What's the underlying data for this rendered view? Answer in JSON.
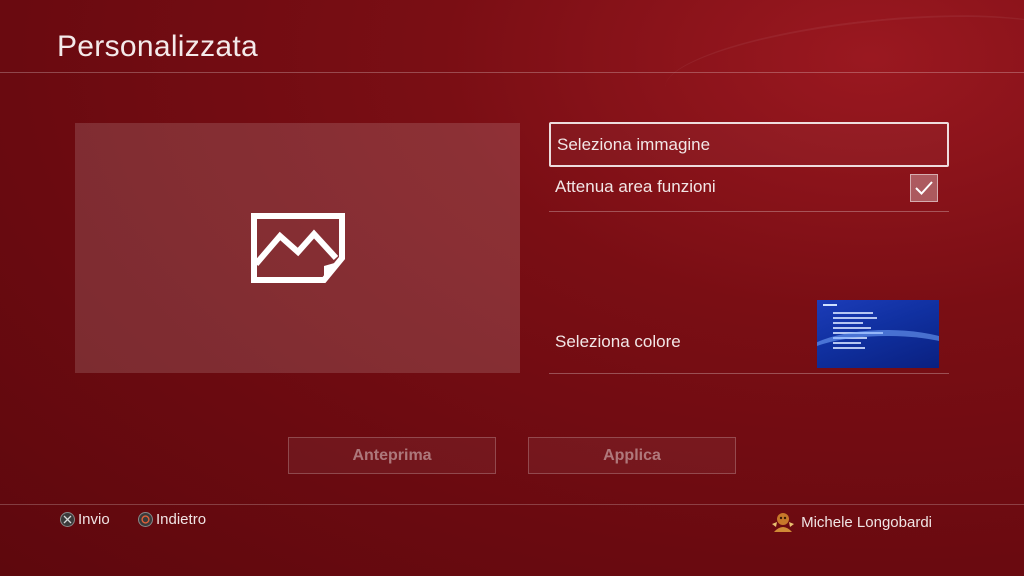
{
  "page": {
    "title": "Personalizzata"
  },
  "preview": {
    "icon": "image-icon"
  },
  "options": {
    "select_image": {
      "label": "Seleziona immagine"
    },
    "dim_function_area": {
      "label": "Attenua area funzioni",
      "checked": true
    },
    "select_color": {
      "label": "Seleziona colore",
      "thumbnail_icon": "theme-thumbnail"
    }
  },
  "buttons": {
    "preview": "Anteprima",
    "apply": "Applica"
  },
  "footer": {
    "enter_label": "Invio",
    "back_label": "Indietro",
    "username": "Michele Longobardi"
  },
  "colors": {
    "background": "#6e0b11",
    "accent_blue": "#1c3cb8"
  }
}
